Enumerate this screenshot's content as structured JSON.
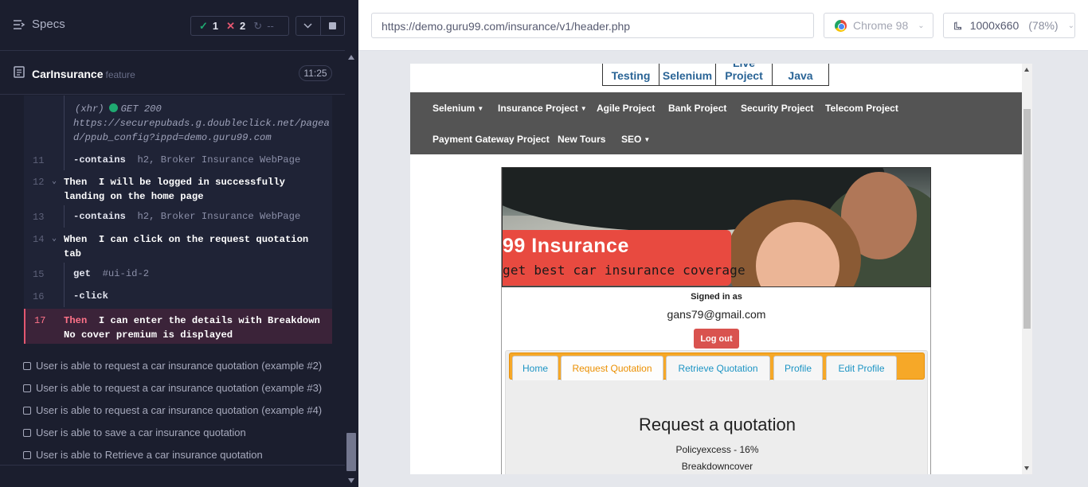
{
  "runner": {
    "specs_label": "Specs",
    "stats": {
      "passed": "1",
      "failed": "2",
      "pending": "--"
    },
    "spec": {
      "name": "CarInsurance",
      "suffix": "feature",
      "duration": "11:25"
    },
    "commands": [
      {
        "line": "",
        "label": "(xhr)",
        "text": "GET 200",
        "url1": "https://securepubads.g.doubleclick.net/pagea",
        "url2": "d/ppub_config?ippd=demo.guru99.com"
      },
      {
        "line": "11",
        "verb": "-contains",
        "arg": "h2, Broker Insurance WebPage"
      },
      {
        "line": "12",
        "keyword": "Then",
        "text1": "I will be logged in successfully",
        "text2": "landing on the home page"
      },
      {
        "line": "13",
        "verb": "-contains",
        "arg": "h2, Broker Insurance WebPage"
      },
      {
        "line": "14",
        "keyword": "When",
        "text1": "I can click on the request quotation",
        "text2": "tab"
      },
      {
        "line": "15",
        "verb": "get",
        "arg": "#ui-id-2"
      },
      {
        "line": "16",
        "verb": "-click",
        "arg": ""
      },
      {
        "line": "17",
        "keyword": "Then",
        "text1": "I can enter the details with Breakdown",
        "text2": "No cover premium is displayed"
      }
    ],
    "tests": [
      "User is able to request a car insurance quotation (example #2)",
      "User is able to request a car insurance quotation (example #3)",
      "User is able to request a car insurance quotation (example #4)",
      "User is able to save a car insurance quotation",
      "User is able to Retrieve a car insurance quotation"
    ]
  },
  "aut": {
    "url": "https://demo.guru99.com/insurance/v1/header.php",
    "browser": "Chrome 98",
    "viewport": "1000x660",
    "zoom": "(78%)",
    "page": {
      "top_menu": [
        "Testing",
        "Selenium",
        "Live Project",
        "Java"
      ],
      "nav_row1": [
        "Selenium",
        "Insurance Project",
        "Agile Project",
        "Bank Project",
        "Security Project",
        "Telecom Project"
      ],
      "nav_row2": [
        "Payment Gateway Project",
        "New Tours",
        "SEO"
      ],
      "banner_title": "99 Insurance",
      "banner_sub": "get best car insurance coverage",
      "signed_in_label": "Signed in as",
      "user_email": "gans79@gmail.com",
      "logout_label": "Log out",
      "tabs": [
        "Home",
        "Request Quotation",
        "Retrieve Quotation",
        "Profile",
        "Edit Profile"
      ],
      "active_tab": "Request Quotation",
      "quote_heading": "Request a quotation",
      "quote_line1": "Policyexcess - 16%",
      "quote_line2": "Breakdowncover"
    }
  },
  "colors": {
    "runner_bg": "#1b1e2e",
    "pass": "#1fa971",
    "fail": "#e45770",
    "nav_dark": "#545454",
    "tabs_orange": "#f6a828",
    "logout_red": "#d9534f"
  }
}
